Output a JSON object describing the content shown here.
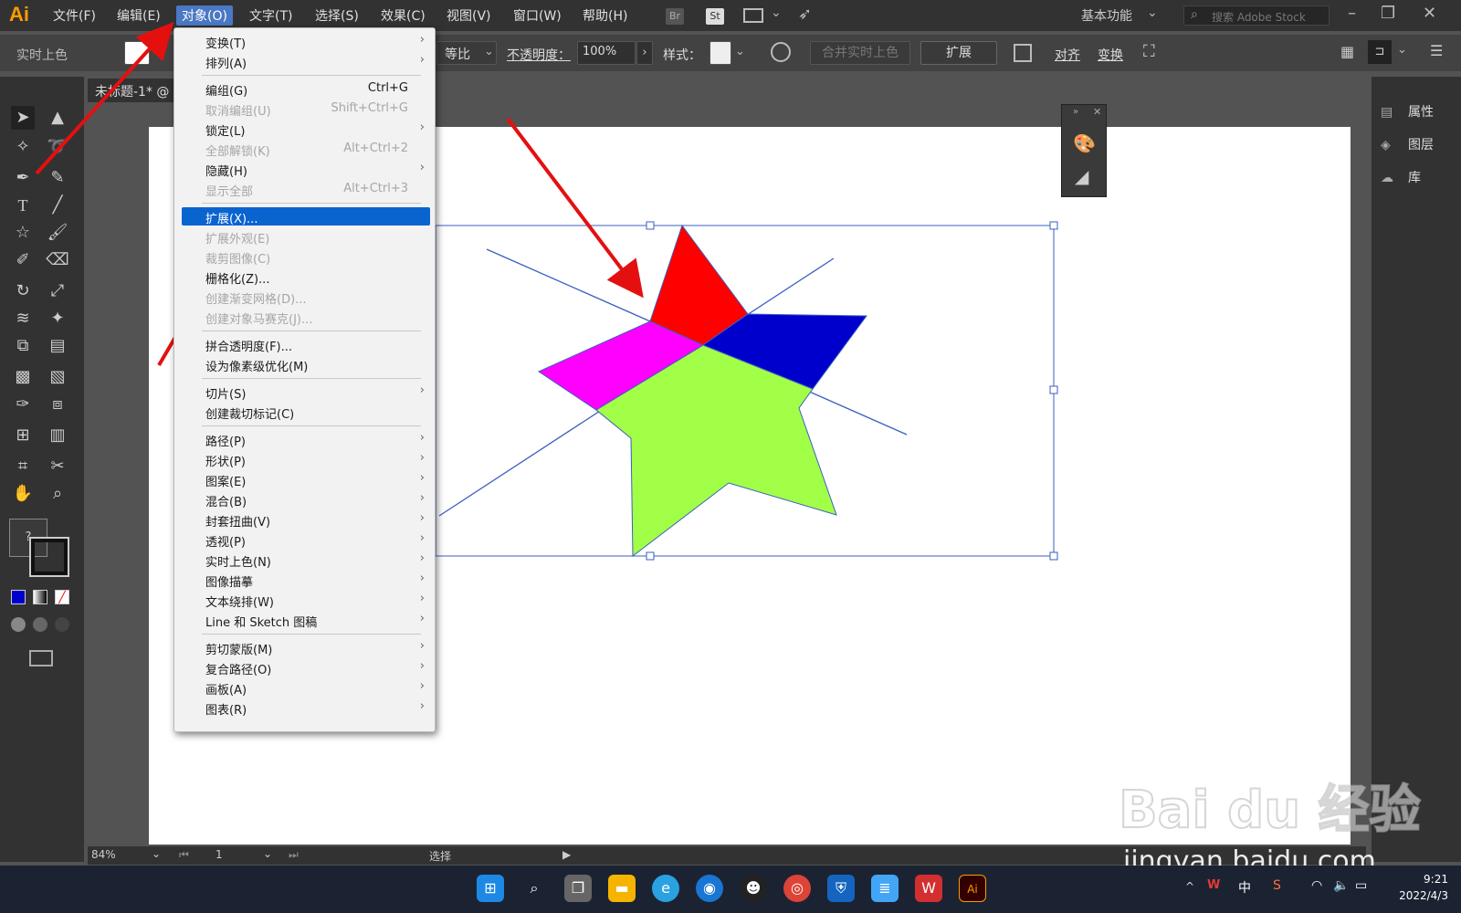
{
  "app": {
    "logo": "Ai"
  },
  "menubar": {
    "items": [
      "文件(F)",
      "编辑(E)",
      "对象(O)",
      "文字(T)",
      "选择(S)",
      "效果(C)",
      "视图(V)",
      "窗口(W)",
      "帮助(H)"
    ],
    "icons": {
      "br": "Br",
      "st": "St"
    },
    "workspace": "基本功能",
    "stock_placeholder": "搜索 Adobe Stock"
  },
  "controlbar": {
    "live_paint_label": "实时上色",
    "uniform_label": "等比",
    "opacity_label": "不透明度：",
    "opacity_value": "100%",
    "style_label": "样式：",
    "merge_live_paint": "合并实时上色",
    "expand_button": "扩展",
    "align_label": "对齐",
    "transform_label": "变换"
  },
  "document": {
    "tab_title": "未标题-1* @"
  },
  "right_panel": {
    "items": [
      "属性",
      "图层",
      "库"
    ]
  },
  "statusbar": {
    "zoom": "84%",
    "page": "1",
    "tool": "选择"
  },
  "context_menu": {
    "items": [
      {
        "label": "变换(T)",
        "shortcut": "",
        "submenu": true,
        "disabled": false
      },
      {
        "label": "排列(A)",
        "shortcut": "",
        "submenu": true,
        "disabled": false
      },
      {
        "label": "编组(G)",
        "shortcut": "Ctrl+G",
        "submenu": false,
        "disabled": false
      },
      {
        "label": "取消编组(U)",
        "shortcut": "Shift+Ctrl+G",
        "submenu": false,
        "disabled": true
      },
      {
        "label": "锁定(L)",
        "shortcut": "",
        "submenu": true,
        "disabled": false
      },
      {
        "label": "全部解锁(K)",
        "shortcut": "Alt+Ctrl+2",
        "submenu": false,
        "disabled": true
      },
      {
        "label": "隐藏(H)",
        "shortcut": "",
        "submenu": true,
        "disabled": false
      },
      {
        "label": "显示全部",
        "shortcut": "Alt+Ctrl+3",
        "submenu": false,
        "disabled": true
      },
      {
        "label": "扩展(X)...",
        "shortcut": "",
        "submenu": false,
        "disabled": false,
        "highlighted": true
      },
      {
        "label": "扩展外观(E)",
        "shortcut": "",
        "submenu": false,
        "disabled": true
      },
      {
        "label": "裁剪图像(C)",
        "shortcut": "",
        "submenu": false,
        "disabled": true
      },
      {
        "label": "栅格化(Z)...",
        "shortcut": "",
        "submenu": false,
        "disabled": false
      },
      {
        "label": "创建渐变网格(D)...",
        "shortcut": "",
        "submenu": false,
        "disabled": true
      },
      {
        "label": "创建对象马赛克(J)...",
        "shortcut": "",
        "submenu": false,
        "disabled": true
      },
      {
        "label": "拼合透明度(F)...",
        "shortcut": "",
        "submenu": false,
        "disabled": false
      },
      {
        "label": "设为像素级优化(M)",
        "shortcut": "",
        "submenu": false,
        "disabled": false
      },
      {
        "label": "切片(S)",
        "shortcut": "",
        "submenu": true,
        "disabled": false
      },
      {
        "label": "创建裁切标记(C)",
        "shortcut": "",
        "submenu": false,
        "disabled": false
      },
      {
        "label": "路径(P)",
        "shortcut": "",
        "submenu": true,
        "disabled": false
      },
      {
        "label": "形状(P)",
        "shortcut": "",
        "submenu": true,
        "disabled": false
      },
      {
        "label": "图案(E)",
        "shortcut": "",
        "submenu": true,
        "disabled": false
      },
      {
        "label": "混合(B)",
        "shortcut": "",
        "submenu": true,
        "disabled": false
      },
      {
        "label": "封套扭曲(V)",
        "shortcut": "",
        "submenu": true,
        "disabled": false
      },
      {
        "label": "透视(P)",
        "shortcut": "",
        "submenu": true,
        "disabled": false
      },
      {
        "label": "实时上色(N)",
        "shortcut": "",
        "submenu": true,
        "disabled": false
      },
      {
        "label": "图像描摹",
        "shortcut": "",
        "submenu": true,
        "disabled": false
      },
      {
        "label": "文本绕排(W)",
        "shortcut": "",
        "submenu": true,
        "disabled": false
      },
      {
        "label": "Line 和 Sketch 图稿",
        "shortcut": "",
        "submenu": true,
        "disabled": false
      },
      {
        "label": "剪切蒙版(M)",
        "shortcut": "",
        "submenu": true,
        "disabled": false
      },
      {
        "label": "复合路径(O)",
        "shortcut": "",
        "submenu": true,
        "disabled": false
      },
      {
        "label": "画板(A)",
        "shortcut": "",
        "submenu": true,
        "disabled": false
      },
      {
        "label": "图表(R)",
        "shortcut": "",
        "submenu": true,
        "disabled": false
      }
    ]
  },
  "artwork_colors": {
    "red": "#ff0000",
    "blue": "#0000cc",
    "magenta": "#ff00ff",
    "green": "#a2ff48",
    "outline": "#3a5fbf"
  },
  "taskbar": {
    "ime": "中",
    "time": "9:21",
    "date": "2022/4/3",
    "apps": [
      "start-icon",
      "search-icon",
      "task-view-icon",
      "file-explorer-icon",
      "edge-icon",
      "zoom-icon",
      "qq-icon",
      "chrome-icon",
      "security-icon",
      "notepad-icon",
      "wps-icon",
      "illustrator-icon"
    ]
  },
  "watermark": {
    "brand": "Bai du 经验",
    "url": "jingyan.baidu.com"
  }
}
